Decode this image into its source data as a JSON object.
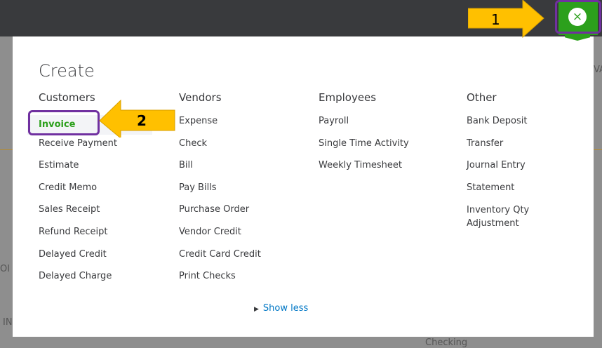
{
  "background": {
    "fragments": [
      "VA",
      "OI",
      "IN",
      "Checking"
    ]
  },
  "modal": {
    "title": "Create",
    "columns": [
      {
        "heading": "Customers",
        "items": [
          "Invoice",
          "Receive Payment",
          "Estimate",
          "Credit Memo",
          "Sales Receipt",
          "Refund Receipt",
          "Delayed Credit",
          "Delayed Charge"
        ]
      },
      {
        "heading": "Vendors",
        "items": [
          "Expense",
          "Check",
          "Bill",
          "Pay Bills",
          "Purchase Order",
          "Vendor Credit",
          "Credit Card Credit",
          "Print Checks"
        ]
      },
      {
        "heading": "Employees",
        "items": [
          "Payroll",
          "Single Time Activity",
          "Weekly Timesheet"
        ]
      },
      {
        "heading": "Other",
        "items": [
          "Bank Deposit",
          "Transfer",
          "Journal Entry",
          "Statement",
          "Inventory Qty Adjustment"
        ]
      }
    ],
    "show_less": "Show less",
    "close_icon": "×"
  },
  "annotations": {
    "step1": "1",
    "step2": "2",
    "highlight_color": "#7030a0",
    "arrow_color": "#ffc000"
  }
}
